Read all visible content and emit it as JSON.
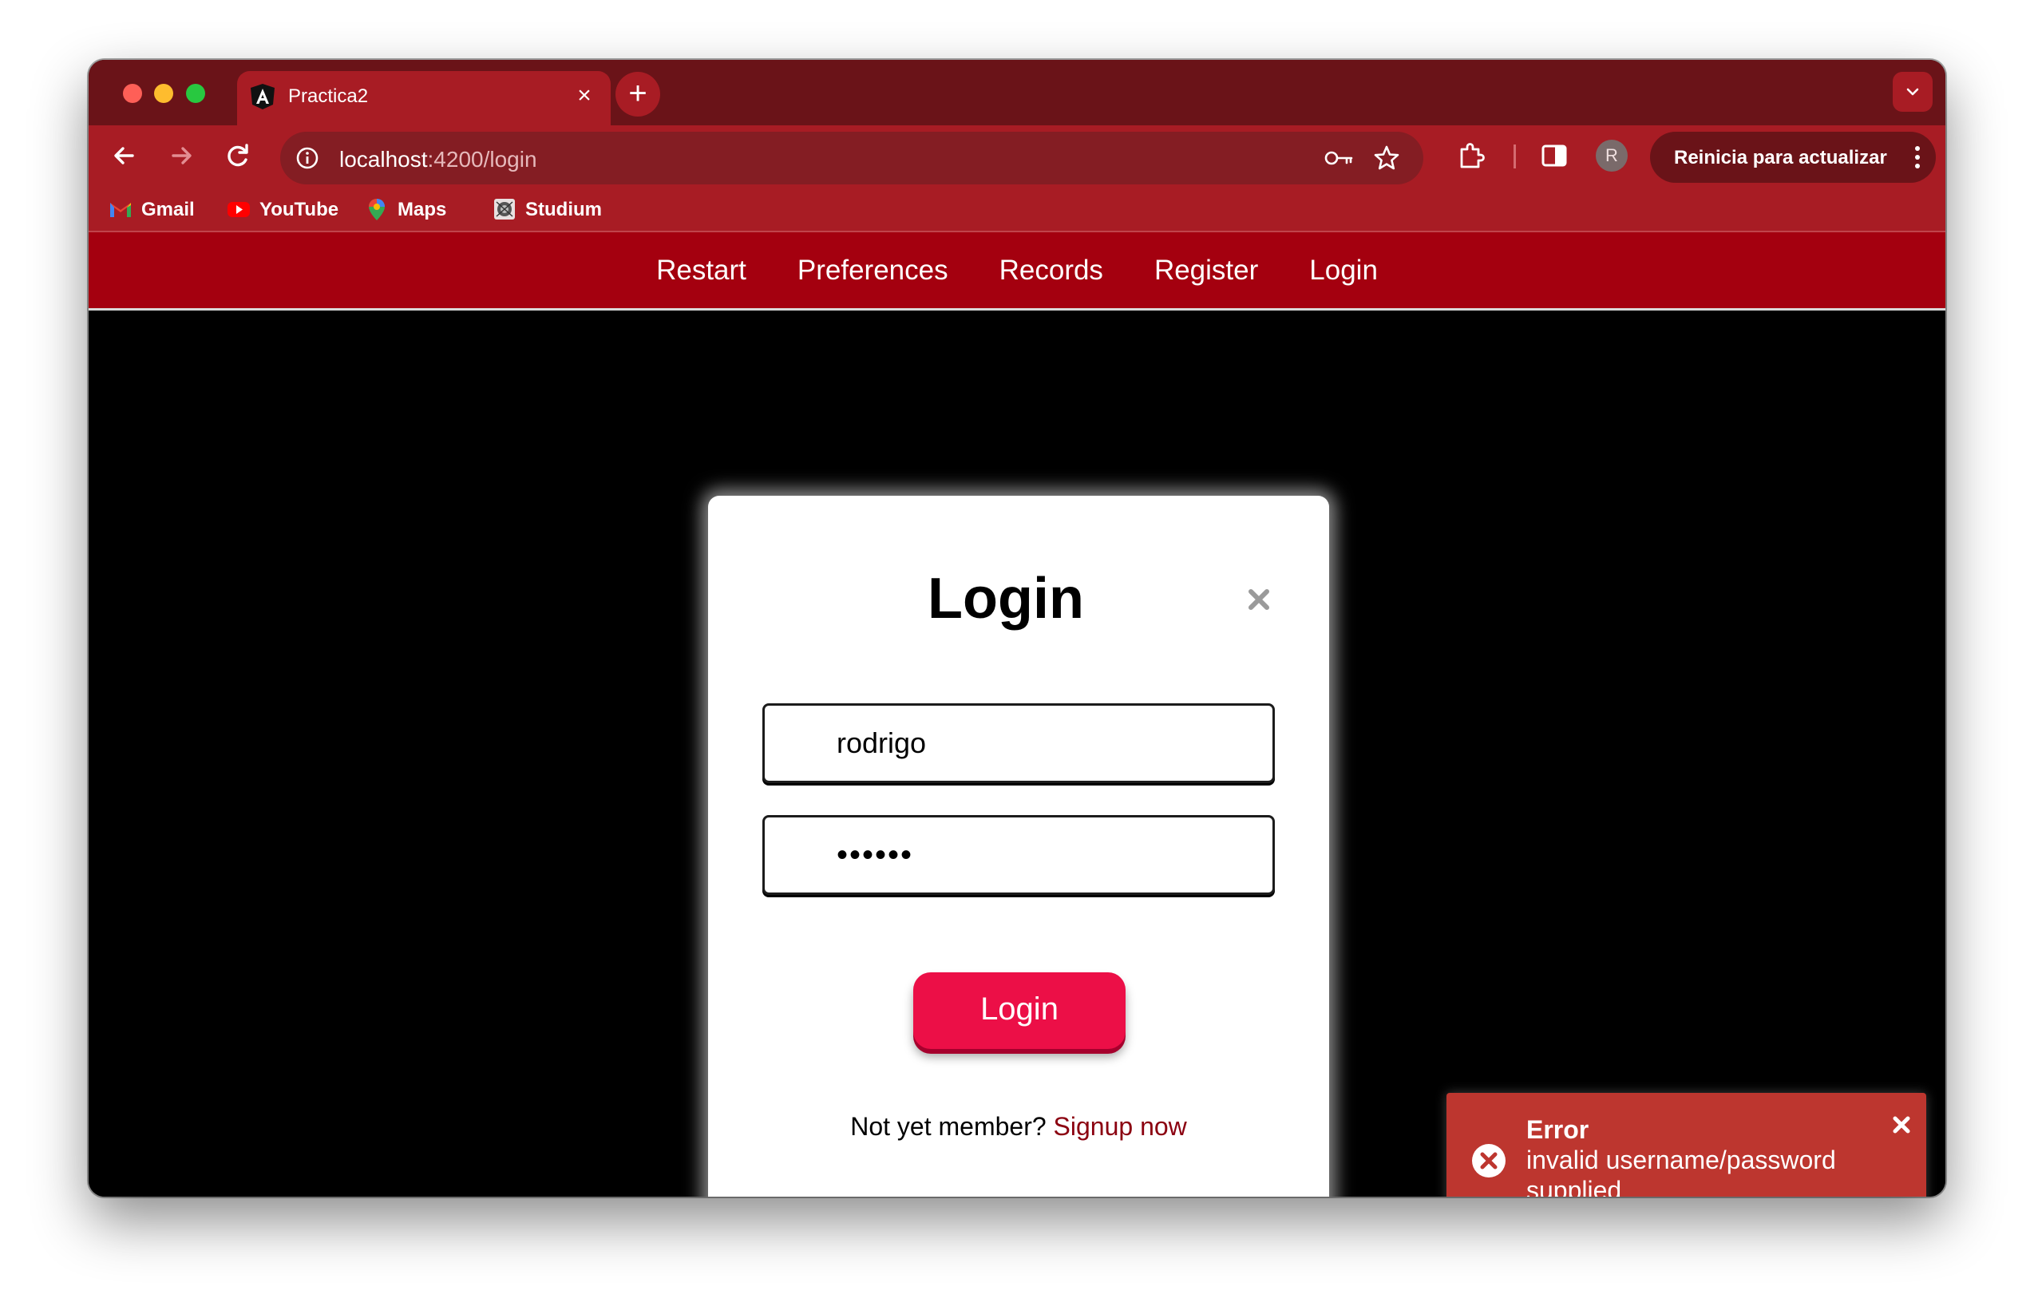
{
  "browser": {
    "tab": {
      "title": "Practica2",
      "icon": "angular-logo-icon"
    },
    "new_tab_label": "+",
    "address": {
      "host": "localhost",
      "rest": ":4200/login"
    },
    "update_button": "Reinicia para actualizar",
    "avatar_initial": "R",
    "bookmarks": [
      {
        "label": "Gmail",
        "icon": "gmail-icon"
      },
      {
        "label": "YouTube",
        "icon": "youtube-icon"
      },
      {
        "label": "Maps",
        "icon": "maps-icon"
      },
      {
        "label": "Studium",
        "icon": "studium-icon"
      }
    ]
  },
  "app": {
    "nav": [
      "Restart",
      "Preferences",
      "Records",
      "Register",
      "Login"
    ],
    "colors": {
      "nav_bg": "#a4000f",
      "button": "#ec0f47",
      "toast": "#bd362f"
    }
  },
  "login_modal": {
    "title": "Login",
    "username": {
      "value": "rodrigo"
    },
    "password": {
      "value": "••••••"
    },
    "submit_label": "Login",
    "signup_prompt": "Not yet member?",
    "signup_link": "Signup now"
  },
  "toast": {
    "title": "Error",
    "message": "invalid username/password supplied"
  }
}
